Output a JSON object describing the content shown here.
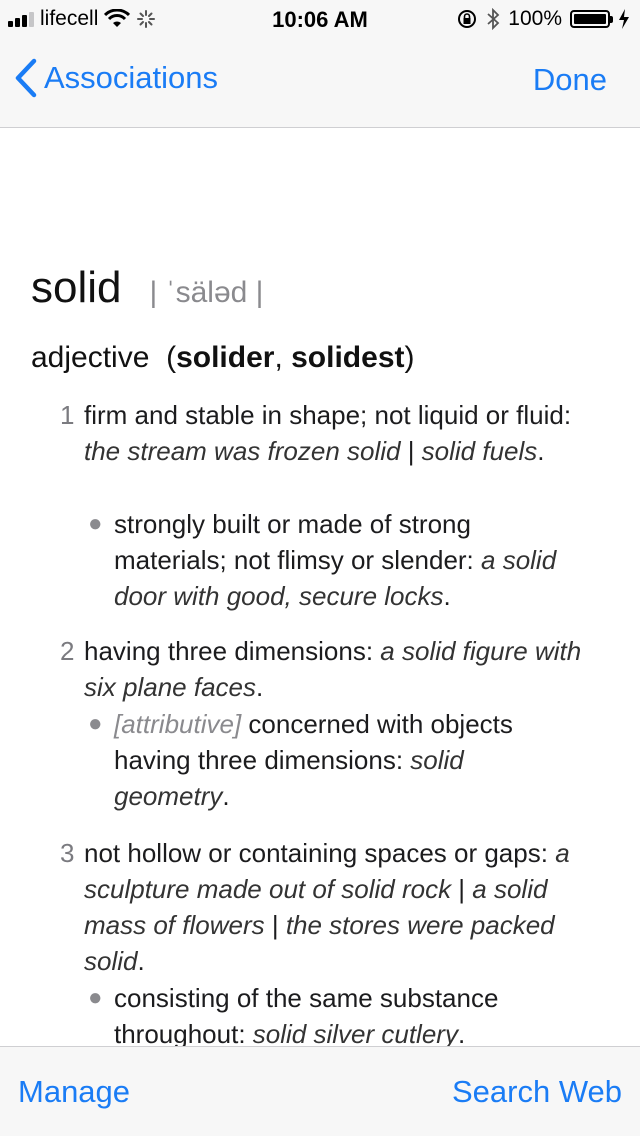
{
  "status_bar": {
    "carrier": "lifecell",
    "time": "10:06 AM",
    "battery": "100%",
    "icons": [
      "signal-icon",
      "wifi-icon",
      "loading-icon",
      "lock-rotation-icon",
      "bluetooth-icon",
      "battery-icon",
      "charging-icon"
    ]
  },
  "nav": {
    "back_label": "Associations",
    "done_label": "Done"
  },
  "entry": {
    "word": "solid",
    "pronunciation": "| ˈsäləd |",
    "part_of_speech": "adjective",
    "forms_open": "(",
    "forms_1": "solider",
    "forms_sep": ", ",
    "forms_2": "solidest",
    "forms_close": ")",
    "senses": [
      {
        "number": "1",
        "definition": "firm and stable in shape; not liquid or fluid: ",
        "example": "the stream was frozen solid",
        "sep": " | ",
        "example2": "solid fuels",
        "end": ".",
        "sub": {
          "definition": "strongly built or made of strong materials; not flimsy or slender: ",
          "example": "a solid door with good, secure locks",
          "end": "."
        }
      },
      {
        "number": "2",
        "definition": "having three dimensions: ",
        "example": "a solid figure with six plane faces",
        "end": ".",
        "sub": {
          "tag": "[attributive]",
          "definition": " concerned with objects having three dimensions: ",
          "example": "solid geometry",
          "end": "."
        }
      },
      {
        "number": "3",
        "definition": "not hollow or containing spaces or gaps: ",
        "example": "a sculpture made out of solid rock",
        "sep": " | ",
        "example2": "a solid mass of flowers",
        "sep2": " | ",
        "example3": "the stores were packed solid",
        "end": ".",
        "sub": {
          "definition": "consisting of the same substance throughout: ",
          "example": "solid silver cutlery",
          "end": "."
        }
      }
    ]
  },
  "toolbar": {
    "manage_label": "Manage",
    "search_web_label": "Search Web"
  },
  "colors": {
    "accent": "#1a7cf5",
    "bar_background": "#f7f7f7"
  }
}
